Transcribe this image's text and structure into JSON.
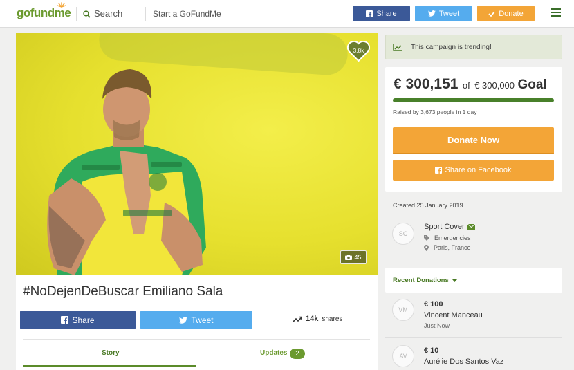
{
  "nav": {
    "logo": "gofundme",
    "search_label": "Search",
    "start_label": "Start a GoFundMe",
    "share_label": "Share",
    "tweet_label": "Tweet",
    "donate_label": "Donate"
  },
  "hero": {
    "hearts": "3.8k",
    "photo_count": "45"
  },
  "campaign": {
    "title": "#NoDejenDeBuscar Emiliano Sala",
    "share_label": "Share",
    "tweet_label": "Tweet",
    "shares_count": "14k",
    "shares_label": "shares",
    "tabs": [
      {
        "label": "Story"
      },
      {
        "label": "Updates",
        "badge": "2"
      }
    ]
  },
  "sidebar": {
    "trending": "This campaign is trending!",
    "raised_amount": "€ 300,151",
    "of_text": "of",
    "goal_amount": "€ 300,000",
    "goal_word": "Goal",
    "progress_fraction": 1.0,
    "raised_text": "Raised by 3,673 people in 1 day",
    "donate_now": "Donate Now",
    "share_facebook": "Share on Facebook",
    "created": "Created 25 January 2019",
    "organizer": {
      "initials": "SC",
      "name": "Sport Cover",
      "category": "Emergencies",
      "location": "Paris, France"
    },
    "recent_donations_label": "Recent Donations",
    "donations": [
      {
        "initials": "VM",
        "amount": "€ 100",
        "name": "Vincent Manceau",
        "time": "Just Now"
      },
      {
        "initials": "AV",
        "amount": "€ 10",
        "name": "Aurélie Dos Santos Vaz",
        "time": ""
      }
    ]
  },
  "colors": {
    "brand_green": "#6b9a2f",
    "facebook": "#3b5998",
    "twitter": "#55acee",
    "orange": "#f3a537"
  }
}
